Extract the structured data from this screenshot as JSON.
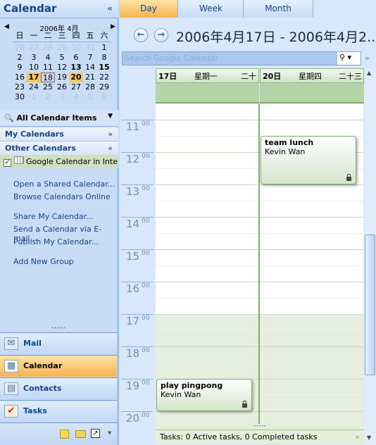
{
  "nav": {
    "title": "Calendar",
    "collapse": "«",
    "mini": {
      "month_title": "2006年 4月",
      "weekdays": [
        "日",
        "一",
        "二",
        "三",
        "四",
        "五",
        "六"
      ],
      "weeks": [
        [
          "26",
          "27",
          "28",
          "29",
          "30",
          "31",
          "1"
        ],
        [
          "2",
          "3",
          "4",
          "5",
          "6",
          "7",
          "8"
        ],
        [
          "9",
          "10",
          "11",
          "12",
          "13",
          "14",
          "15"
        ],
        [
          "16",
          "17",
          "18",
          "19",
          "20",
          "21",
          "22"
        ],
        [
          "23",
          "24",
          "25",
          "26",
          "27",
          "28",
          "29"
        ],
        [
          "30",
          "1",
          "2",
          "3",
          "4",
          "5",
          "6"
        ]
      ],
      "bold_dates": [
        "13",
        "15",
        "17",
        "20"
      ],
      "today": "18",
      "selected": [
        "17",
        "20"
      ]
    },
    "view_selector": "All Calendar Items",
    "my_calendars": "My Calendars",
    "other_calendars": "Other Calendars",
    "calendar_item": "Google Calendar in Inte",
    "links": [
      "Open a Shared Calendar...",
      "Browse Calendars Online",
      "Share My Calendar...",
      "Send a Calendar via E-mail...",
      "Publish My Calendar...",
      "Add New Group"
    ],
    "buttons": [
      {
        "label": "Mail",
        "icon": "mail-icon"
      },
      {
        "label": "Calendar",
        "icon": "calendar-icon",
        "active": true
      },
      {
        "label": "Contacts",
        "icon": "contacts-icon"
      },
      {
        "label": "Tasks",
        "icon": "tasks-icon"
      }
    ]
  },
  "tabs": [
    "Day",
    "Week",
    "Month"
  ],
  "active_tab": "Day",
  "date_range": "2006年4月17日 - 2006年4月2...",
  "search_placeholder": "Search Google Calendar",
  "columns": [
    {
      "day": "17日",
      "weekday": "星期一",
      "lunar": "二十"
    },
    {
      "day": "20日",
      "weekday": "星期四",
      "lunar": "二十三"
    }
  ],
  "hours": [
    "11",
    "12",
    "13",
    "14",
    "15",
    "16",
    "17",
    "18",
    "19",
    "20"
  ],
  "minutes": "00",
  "events": [
    {
      "title": "team lunch",
      "owner": "Kevin Wan",
      "column": 1,
      "start": "11:30",
      "end": "13:00",
      "private": true
    },
    {
      "title": "play pingpong",
      "owner": "Kevin Wan",
      "column": 0,
      "start": "19:00",
      "end": "20:00",
      "private": true
    }
  ],
  "tasks_bar": "Tasks: 0 Active tasks, 0 Completed tasks",
  "colors": {
    "accent": "#f8c860",
    "header": "#15428b",
    "event_border": "#7fac6f"
  }
}
